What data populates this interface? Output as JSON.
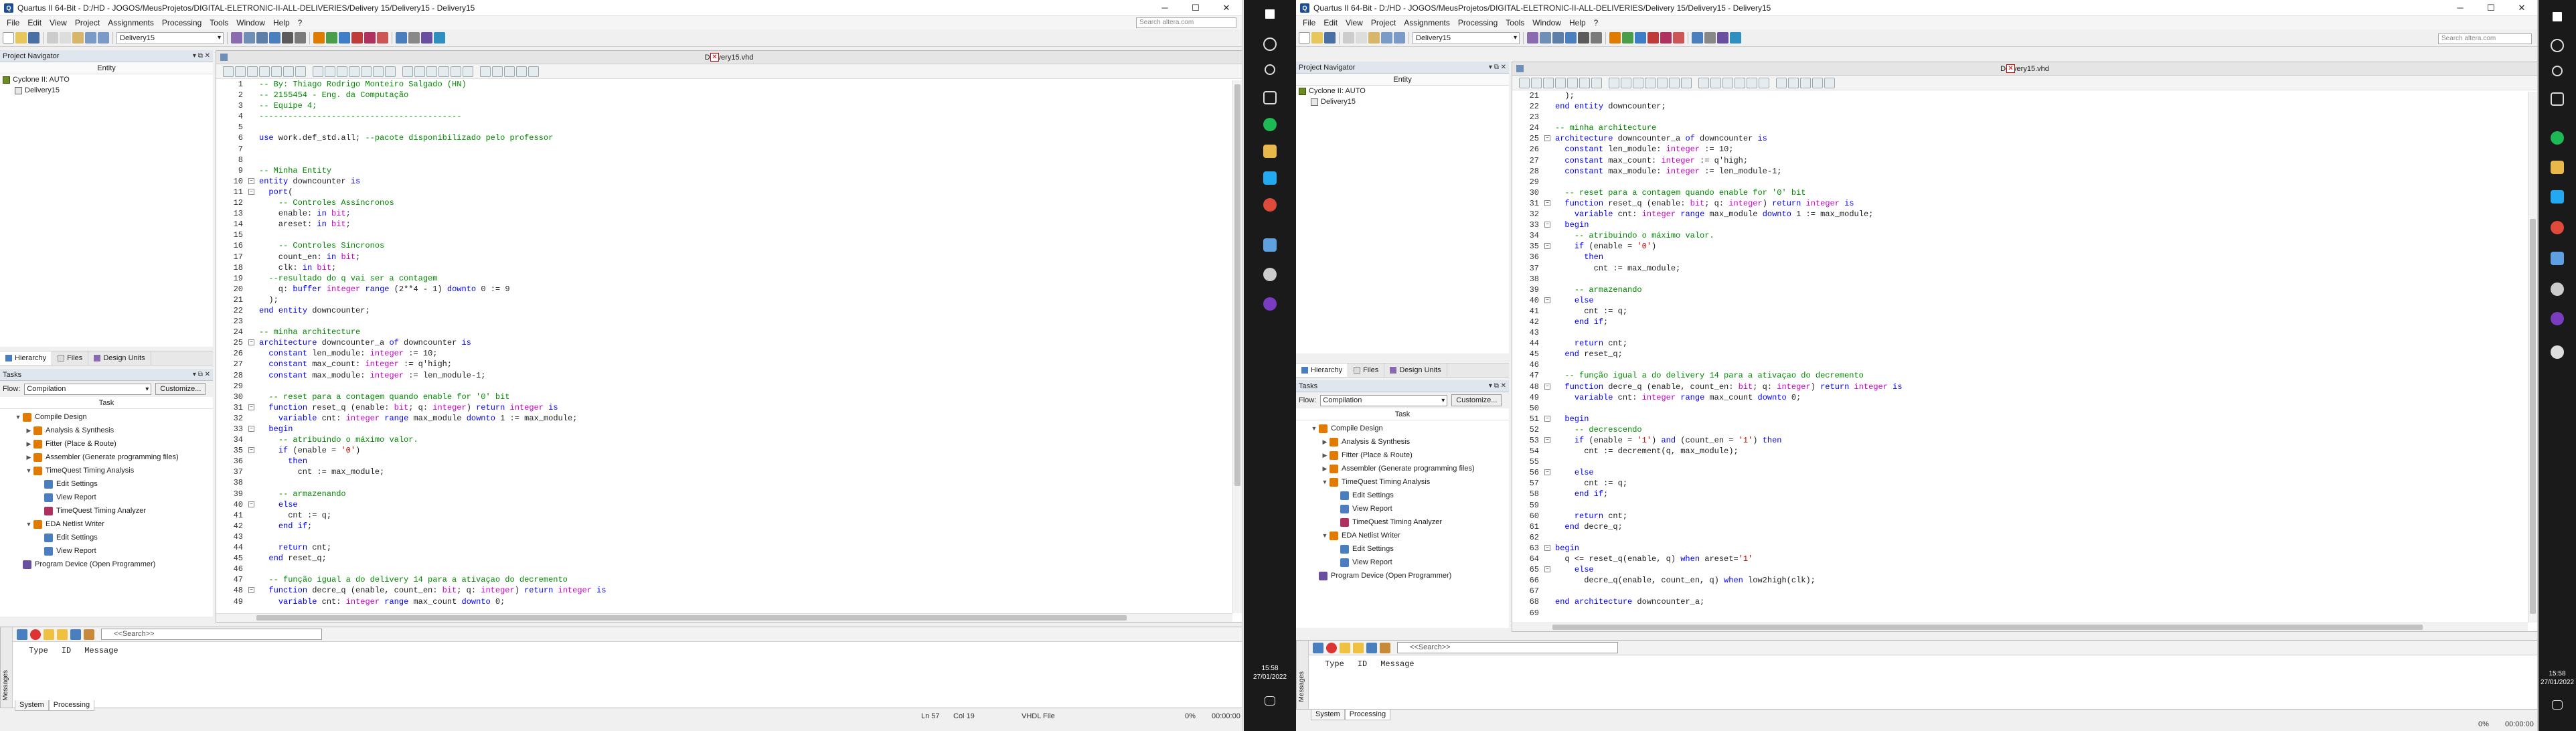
{
  "left": {
    "title": "Quartus II 64-Bit - D:/HD - JOGOS/MeusProjetos/DIGITAL-ELETRONIC-II-ALL-DELIVERIES/Delivery 15/Delivery15 - Delivery15",
    "menu": [
      "File",
      "Edit",
      "View",
      "Project",
      "Assignments",
      "Processing",
      "Tools",
      "Window",
      "Help"
    ],
    "help_icon": "?",
    "search_placeholder": "Search altera.com",
    "entity_combo": "Delivery15",
    "project_navigator": {
      "title": "Project Navigator",
      "column": "Entity",
      "device": "Cyclone II: AUTO",
      "entity": "Delivery15"
    },
    "nav_tabs": [
      "Hierarchy",
      "Files",
      "Design Units"
    ],
    "tasks": {
      "title": "Tasks",
      "flow_label": "Flow:",
      "flow_value": "Compilation",
      "customize": "Customize...",
      "column": "Task",
      "items": [
        {
          "label": "Compile Design",
          "level": 0,
          "arrow": "▼",
          "icon": "#e07b00"
        },
        {
          "label": "Analysis & Synthesis",
          "level": 1,
          "arrow": "▶",
          "icon": "#e07b00"
        },
        {
          "label": "Fitter (Place & Route)",
          "level": 1,
          "arrow": "▶",
          "icon": "#e07b00"
        },
        {
          "label": "Assembler (Generate programming files)",
          "level": 1,
          "arrow": "▶",
          "icon": "#e07b00"
        },
        {
          "label": "TimeQuest Timing Analysis",
          "level": 1,
          "arrow": "▼",
          "icon": "#e07b00"
        },
        {
          "label": "Edit Settings",
          "level": 2,
          "arrow": "",
          "icon": "#4a7fbf"
        },
        {
          "label": "View Report",
          "level": 2,
          "arrow": "",
          "icon": "#4a7fbf"
        },
        {
          "label": "TimeQuest Timing Analyzer",
          "level": 2,
          "arrow": "",
          "icon": "#b03060"
        },
        {
          "label": "EDA Netlist Writer",
          "level": 1,
          "arrow": "▼",
          "icon": "#e07b00"
        },
        {
          "label": "Edit Settings",
          "level": 2,
          "arrow": "",
          "icon": "#4a7fbf"
        },
        {
          "label": "View Report",
          "level": 2,
          "arrow": "",
          "icon": "#4a7fbf"
        },
        {
          "label": "Program Device (Open Programmer)",
          "level": 0,
          "arrow": "",
          "icon": "#6a4fa0"
        }
      ]
    },
    "doc_tab": "Delivery15.vhd",
    "code_start": 1,
    "code": [
      "-- By: Thiago Rodrigo Monteiro Salgado (HN)",
      "-- 2155454 - Eng. da Computação",
      "-- Equipe 4;",
      "------------------------------------------",
      "",
      "use work.def_std.all; --pacote disponibilizado pelo professor",
      "",
      "",
      "-- Minha Entity",
      "entity downcounter is",
      "  port(",
      "    -- Controles Assíncronos",
      "    enable: in bit;",
      "    areset: in bit;",
      "",
      "    -- Controles Síncronos",
      "    count_en: in bit;",
      "    clk: in bit;",
      "  --resultado do q vai ser a contagem",
      "    q: buffer integer range (2**4 - 1) downto 0 := 9",
      "  );",
      "end entity downcounter;",
      "",
      "-- minha architecture",
      "architecture downcounter_a of downcounter is",
      "  constant len_module: integer := 10;",
      "  constant max_count: integer := q'high;",
      "  constant max_module: integer := len_module-1;",
      "",
      "  -- reset para a contagem quando enable for '0' bit",
      "  function reset_q (enable: bit; q: integer) return integer is",
      "    variable cnt: integer range max_module downto 1 := max_module;",
      "  begin",
      "    -- atribuindo o máximo valor.",
      "    if (enable = '0')",
      "      then",
      "        cnt := max_module;",
      "",
      "    -- armazenando",
      "    else",
      "      cnt := q;",
      "    end if;",
      "",
      "    return cnt;",
      "  end reset_q;",
      "",
      "  -- função igual a do delivery 14 para a ativaçao do decremento",
      "  function decre_q (enable, count_en: bit; q: integer) return integer is",
      "    variable cnt: integer range max_count downto 0;"
    ],
    "messages": {
      "col_type": "Type",
      "col_id": "ID",
      "col_message": "Message",
      "search": "<<Search>>",
      "side": "Messages",
      "tabs": [
        "System",
        "Processing"
      ]
    },
    "status": {
      "pos": "Ln 57",
      "col": "Col 19",
      "file": "VHDL File",
      "pct": "0%",
      "time": "00:00:00"
    }
  },
  "right": {
    "title": "Quartus II 64-Bit - D:/HD - JOGOS/MeusProjetos/DIGITAL-ELETRONIC-II-ALL-DELIVERIES/Delivery 15/Delivery15 - Delivery15",
    "menu": [
      "File",
      "Edit",
      "View",
      "Project",
      "Assignments",
      "Processing",
      "Tools",
      "Window",
      "Help"
    ],
    "help_icon": "?",
    "search_placeholder": "Search altera.com",
    "entity_combo": "Delivery15",
    "project_navigator": {
      "title": "Project Navigator",
      "column": "Entity",
      "device": "Cyclone II: AUTO",
      "entity": "Delivery15"
    },
    "nav_tabs": [
      "Hierarchy",
      "Files",
      "Design Units"
    ],
    "tasks": {
      "title": "Tasks",
      "flow_label": "Flow:",
      "flow_value": "Compilation",
      "customize": "Customize...",
      "column": "Task",
      "items": [
        {
          "label": "Compile Design",
          "level": 0,
          "arrow": "▼",
          "icon": "#e07b00"
        },
        {
          "label": "Analysis & Synthesis",
          "level": 1,
          "arrow": "▶",
          "icon": "#e07b00"
        },
        {
          "label": "Fitter (Place & Route)",
          "level": 1,
          "arrow": "▶",
          "icon": "#e07b00"
        },
        {
          "label": "Assembler (Generate programming files)",
          "level": 1,
          "arrow": "▶",
          "icon": "#e07b00"
        },
        {
          "label": "TimeQuest Timing Analysis",
          "level": 1,
          "arrow": "▼",
          "icon": "#e07b00"
        },
        {
          "label": "Edit Settings",
          "level": 2,
          "arrow": "",
          "icon": "#4a7fbf"
        },
        {
          "label": "View Report",
          "level": 2,
          "arrow": "",
          "icon": "#4a7fbf"
        },
        {
          "label": "TimeQuest Timing Analyzer",
          "level": 2,
          "arrow": "",
          "icon": "#b03060"
        },
        {
          "label": "EDA Netlist Writer",
          "level": 1,
          "arrow": "▼",
          "icon": "#e07b00"
        },
        {
          "label": "Edit Settings",
          "level": 2,
          "arrow": "",
          "icon": "#4a7fbf"
        },
        {
          "label": "View Report",
          "level": 2,
          "arrow": "",
          "icon": "#4a7fbf"
        },
        {
          "label": "Program Device (Open Programmer)",
          "level": 0,
          "arrow": "",
          "icon": "#6a4fa0"
        }
      ]
    },
    "doc_tab": "Delivery15.vhd",
    "code_start": 21,
    "code": [
      "  );",
      "end entity downcounter;",
      "",
      "-- minha architecture",
      "architecture downcounter_a of downcounter is",
      "  constant len_module: integer := 10;",
      "  constant max_count: integer := q'high;",
      "  constant max_module: integer := len_module-1;",
      "",
      "  -- reset para a contagem quando enable for '0' bit",
      "  function reset_q (enable: bit; q: integer) return integer is",
      "    variable cnt: integer range max_module downto 1 := max_module;",
      "  begin",
      "    -- atribuindo o máximo valor.",
      "    if (enable = '0')",
      "      then",
      "        cnt := max_module;",
      "",
      "    -- armazenando",
      "    else",
      "      cnt := q;",
      "    end if;",
      "",
      "    return cnt;",
      "  end reset_q;",
      "",
      "  -- função igual a do delivery 14 para a ativaçao do decremento",
      "  function decre_q (enable, count_en: bit; q: integer) return integer is",
      "    variable cnt: integer range max_count downto 0;",
      "",
      "  begin",
      "    -- decrescendo",
      "    if (enable = '1') and (count_en = '1') then",
      "      cnt := decrement(q, max_module);",
      "",
      "    else",
      "      cnt := q;",
      "    end if;",
      "",
      "    return cnt;",
      "  end decre_q;",
      "",
      "begin",
      "  q <= reset_q(enable, q) when areset='1'",
      "    else",
      "      decre_q(enable, count_en, q) when low2high(clk);",
      "",
      "end architecture downcounter_a;",
      ""
    ],
    "messages": {
      "col_type": "Type",
      "col_id": "ID",
      "col_message": "Message",
      "search": "<<Search>>",
      "side": "Messages",
      "tabs": [
        "System",
        "Processing"
      ]
    },
    "status": {
      "pct": "0%",
      "time": "00:00:00"
    }
  },
  "taskbar": {
    "time": "15:58",
    "date": "27/01/2022",
    "time_right": "15:58",
    "date_right": "27/01/2022"
  },
  "window_buttons": {
    "min": "─",
    "max": "☐",
    "close": "✕"
  }
}
